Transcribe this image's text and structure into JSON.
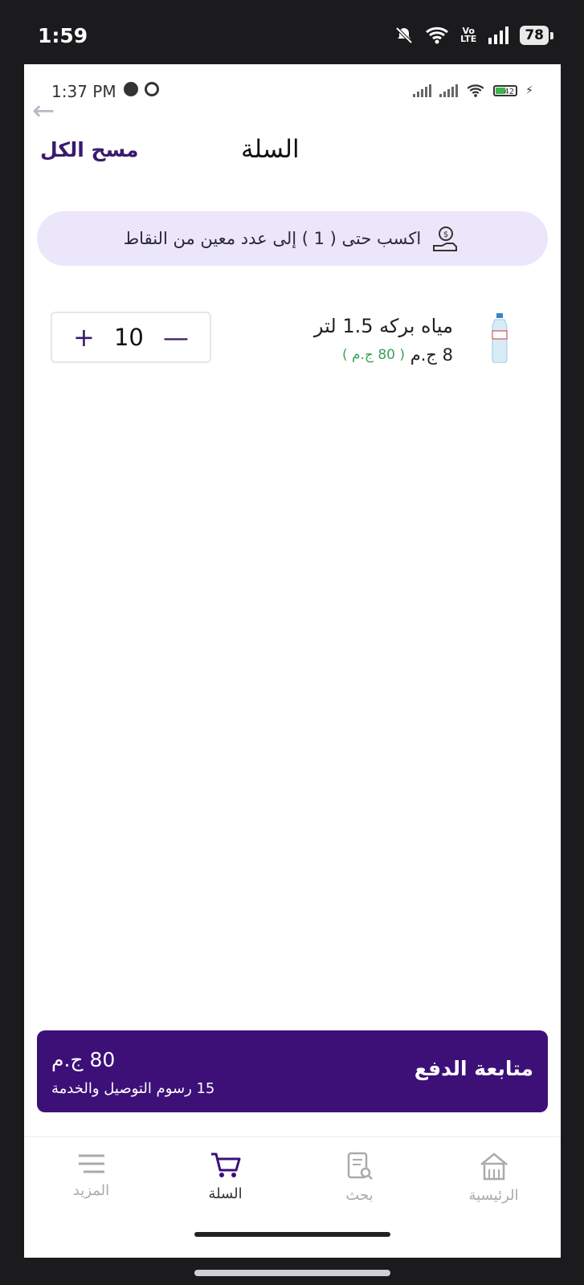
{
  "device_status": {
    "time": "1:59",
    "battery": "78",
    "network": "Vo LTE"
  },
  "app_status": {
    "time": "1:37 PM",
    "battery": "42"
  },
  "header": {
    "title": "السلة",
    "clear_all": "مسح الكل"
  },
  "points_banner": {
    "text": "اكسب حتى ( 1 ) إلى عدد معين من النقاط"
  },
  "cart": {
    "items": [
      {
        "name": "مياه بركه 1.5 لتر",
        "unit_price": "8 ج.م",
        "line_total": "( 80 ج.م )",
        "quantity": "10"
      }
    ]
  },
  "checkout": {
    "label": "متابعة الدفع",
    "total": "80 ج.م",
    "fees_note": "15 رسوم التوصيل والخدمة"
  },
  "bottom_nav": {
    "items": [
      {
        "label": "المزيد",
        "icon": "menu-icon"
      },
      {
        "label": "السلة",
        "icon": "cart-icon",
        "active": true
      },
      {
        "label": "بحث",
        "icon": "search-document-icon"
      },
      {
        "label": "الرئيسية",
        "icon": "home-icon"
      }
    ]
  },
  "colors": {
    "primary": "#3d1078",
    "banner_bg": "#ece6fb",
    "price_green": "#3aa15a"
  }
}
